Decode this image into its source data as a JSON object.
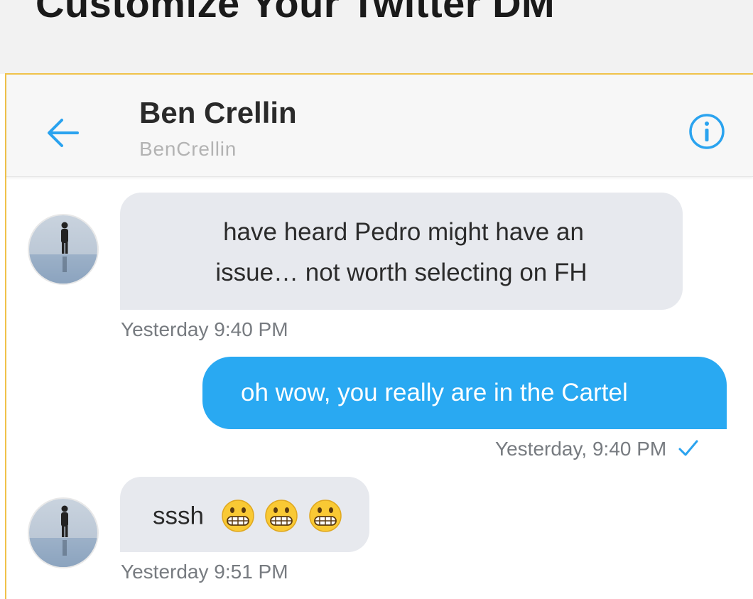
{
  "page": {
    "title": "Customize Your Twitter DM"
  },
  "header": {
    "name": "Ben Crellin",
    "handle": "BenCrellin",
    "back_icon": "arrow-left-icon",
    "info_icon": "info-circle-icon",
    "accent": "#2aa3ef"
  },
  "messages": [
    {
      "direction": "incoming",
      "lines": [
        "have heard Pedro might have an",
        "issue… not worth selecting on FH"
      ],
      "time": "Yesterday 9:40 PM"
    },
    {
      "direction": "outgoing",
      "text": "oh wow, you really are in the Cartel",
      "time": "Yesterday, 9:40 PM",
      "status_icon": "checkmark-icon"
    },
    {
      "direction": "incoming",
      "text": "sssh",
      "emoji": [
        "grimacing-face",
        "grimacing-face",
        "grimacing-face"
      ],
      "time": "Yesterday 9:51 PM"
    }
  ],
  "colors": {
    "incoming_bubble": "#e7e9ee",
    "outgoing_bubble": "#29a9f2",
    "frame_border": "#f0c24a"
  }
}
